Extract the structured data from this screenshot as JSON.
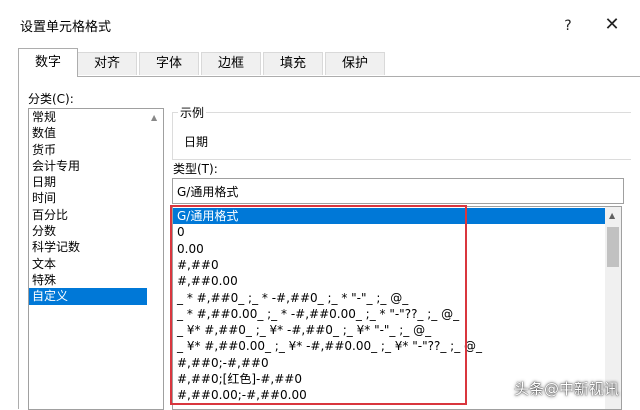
{
  "window": {
    "title": "设置单元格格式",
    "help": "?",
    "close": "✕"
  },
  "tabs": [
    "数字",
    "对齐",
    "字体",
    "边框",
    "填充",
    "保护"
  ],
  "category": {
    "label": "分类(C):",
    "items": [
      "常规",
      "数值",
      "货币",
      "会计专用",
      "日期",
      "时间",
      "百分比",
      "分数",
      "科学记数",
      "文本",
      "特殊",
      "自定义"
    ],
    "selected_index": 11
  },
  "sample": {
    "legend": "示例",
    "value": "日期"
  },
  "type": {
    "label": "类型(T):",
    "input_value": "G/通用格式",
    "formats": [
      "G/通用格式",
      "0",
      "0.00",
      "#,##0",
      "#,##0.00",
      "_ * #,##0_ ;_ * -#,##0_ ;_ * \"-\"_ ;_ @_",
      "_ * #,##0.00_ ;_ * -#,##0.00_ ;_ * \"-\"??_ ;_ @_",
      "_ ¥* #,##0_ ;_ ¥* -#,##0_ ;_ ¥* \"-\"_ ;_ @_",
      "_ ¥* #,##0.00_ ;_ ¥* -#,##0.00_ ;_ ¥* \"-\"??_ ;_ @_",
      "#,##0;-#,##0",
      "#,##0;[红色]-#,##0",
      "#,##0.00;-#,##0.00"
    ],
    "selected_index": 0
  },
  "watermark": "头条@中新视讯",
  "colors": {
    "selection": "#0078d7",
    "highlight_box": "#d9363e"
  }
}
